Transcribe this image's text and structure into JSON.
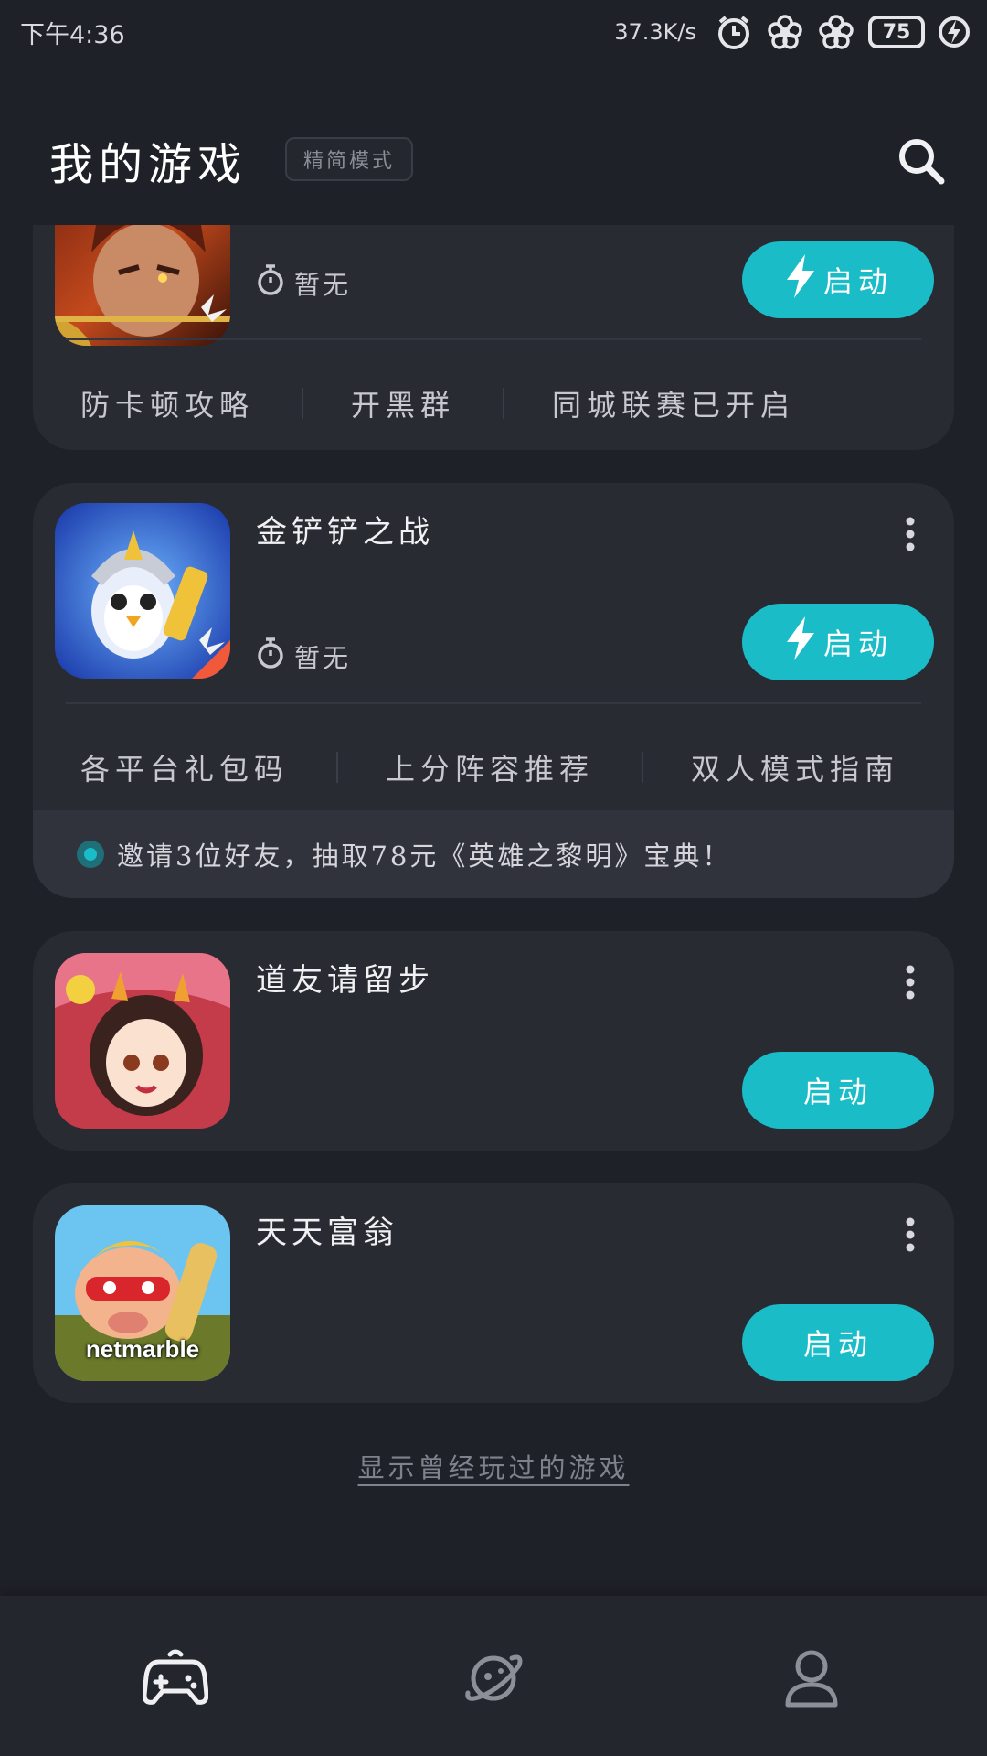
{
  "status_bar": {
    "time": "下午4:36",
    "net_speed": "37.3K/s",
    "battery": "75"
  },
  "header": {
    "title": "我的游戏",
    "mode_label": "精简模式"
  },
  "cards": [
    {
      "time": "暂无",
      "launch_label": "启动",
      "links": [
        "防卡顿攻略",
        "开黑群",
        "同城联赛已开启"
      ]
    },
    {
      "name": "金铲铲之战",
      "time": "暂无",
      "launch_label": "启动",
      "links": [
        "各平台礼包码",
        "上分阵容推荐",
        "双人模式指南"
      ],
      "invite": "邀请3位好友，抽取78元《英雄之黎明》宝典！"
    },
    {
      "name": "道友请留步",
      "launch_label": "启动"
    },
    {
      "name": "天天富翁",
      "launch_label": "启动",
      "icon_brand": "netmarble"
    }
  ],
  "show_played_label": "显示曾经玩过的游戏",
  "nav": {
    "items": [
      "game-controller-icon",
      "planet-icon",
      "profile-icon"
    ]
  },
  "colors": {
    "background": "#1f2128",
    "card": "#292b33",
    "accent": "#19bcc7"
  }
}
